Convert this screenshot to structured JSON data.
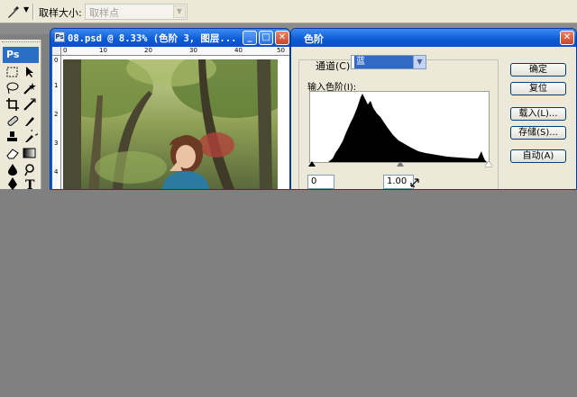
{
  "options_bar": {
    "tool_icon": "eyedropper-icon",
    "sample_size_label": "取样大小:",
    "sample_size_value": "取样点"
  },
  "toolbox": {
    "logo": "Ps",
    "tools": [
      "marquee-icon",
      "move-icon",
      "lasso-icon",
      "magic-wand-icon",
      "crop-icon",
      "slice-icon",
      "healing-icon",
      "brush-icon",
      "stamp-icon",
      "history-brush-icon",
      "eraser-icon",
      "gradient-icon",
      "blur-icon",
      "dodge-icon",
      "pen-icon",
      "type-icon"
    ]
  },
  "document": {
    "title": "08.psd @ 8.33% (色阶 3, 图层...",
    "ruler_top": [
      "0",
      "10",
      "20",
      "30",
      "40",
      "50"
    ],
    "ruler_left": [
      "0",
      "1",
      "2",
      "3",
      "4"
    ],
    "minimize_icon": "minimize-icon",
    "maximize_icon": "maximize-icon",
    "close_icon": "close-icon"
  },
  "levels_dialog": {
    "title": "色阶",
    "channel_label": "通道(C):",
    "channel_value": "蓝",
    "input_levels_label": "输入色阶(I):",
    "input_black": "0",
    "input_gamma": "1.00",
    "buttons": {
      "ok": "确定",
      "reset": "复位",
      "load": "载入(L)...",
      "save": "存储(S)...",
      "auto": "自动(A)"
    },
    "colors": {
      "titlebar": "#0a5bd6",
      "histogram": "#000000"
    }
  }
}
